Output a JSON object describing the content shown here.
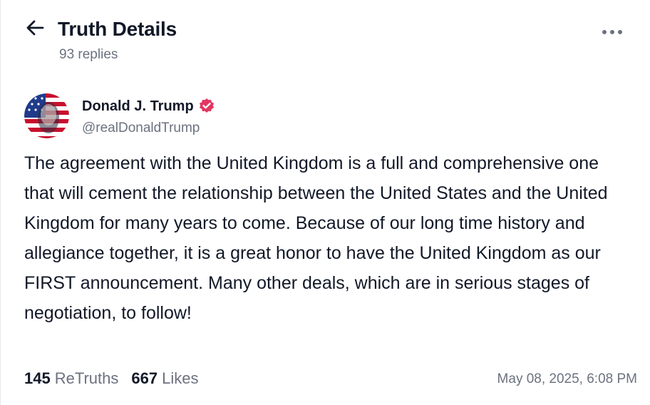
{
  "header": {
    "title": "Truth Details",
    "replies": "93 replies",
    "back_icon": "arrow-left-icon",
    "more_icon": "more-horizontal-icon"
  },
  "post": {
    "author": {
      "name": "Donald J. Trump",
      "handle": "@realDonaldTrump",
      "verified_icon": "verified-badge-icon"
    },
    "text": "The agreement with the United Kingdom is a full and comprehensive one that will cement the relationship between the United States and the United Kingdom for many years to come. Because of our long time history and allegiance together, it is a great honor to have the United Kingdom as our FIRST announcement. Many other deals, which are in serious stages of negotiation, to follow!",
    "retruths_count": "145",
    "retruths_label": "ReTruths",
    "likes_count": "667",
    "likes_label": "Likes",
    "timestamp": "May 08, 2025, 6:08 PM"
  },
  "colors": {
    "text_primary": "#111827",
    "text_secondary": "#6b7280",
    "verified": "#e23661"
  }
}
